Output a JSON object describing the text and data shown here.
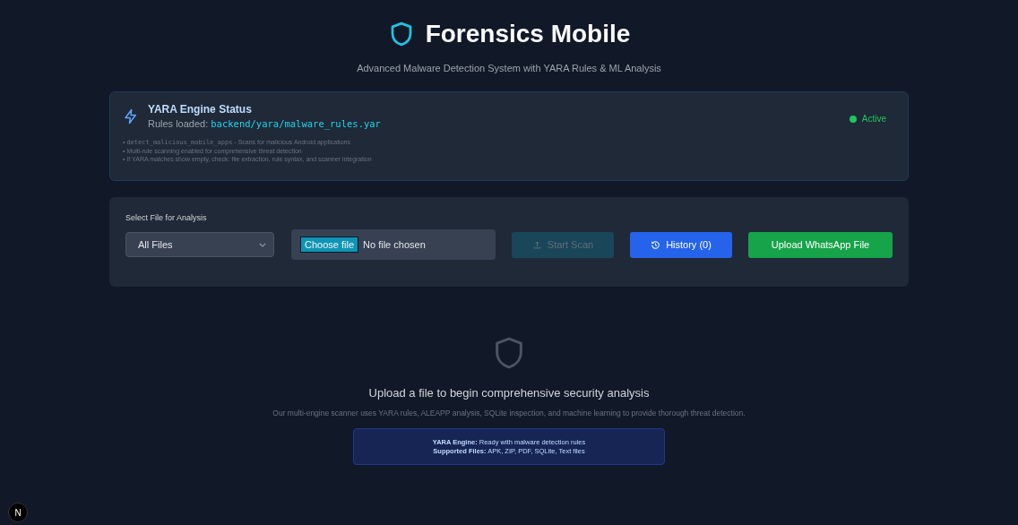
{
  "header": {
    "title": "Forensics Mobile",
    "subtitle": "Advanced Malware Detection System with YARA Rules & ML Analysis"
  },
  "engine_status": {
    "title": "YARA Engine Status",
    "rules_label": "Rules loaded:",
    "rules_path": "backend/yara/malware_rules.yar",
    "status": {
      "label": "Active",
      "active": true
    },
    "notes": [
      {
        "bullet": "•",
        "code": "detect_malicious_mobile_apps",
        "text": " - Scans for malicious Android applications"
      },
      {
        "bullet": "•",
        "text": "Multi-rule scanning enabled for comprehensive threat detection"
      },
      {
        "bullet": "•",
        "text": "If YARA matches show empty, check: file extraction, rule syntax, and scanner integration"
      }
    ]
  },
  "file_panel": {
    "label": "Select File for Analysis",
    "file_type": {
      "value": "All Files"
    },
    "file_input": {
      "button": "Choose file",
      "status": "No file chosen"
    },
    "buttons": [
      {
        "kind": "scan",
        "label": "Start Scan",
        "disabled": true
      },
      {
        "kind": "history",
        "label": "History (0)",
        "disabled": false
      },
      {
        "kind": "whatsapp",
        "label": "Upload WhatsApp File",
        "disabled": false
      }
    ]
  },
  "empty_state": {
    "heading": "Upload a file to begin comprehensive security analysis",
    "description": "Our multi-engine scanner uses YARA rules, ALEAPP analysis, SQLite inspection, and machine learning to provide thorough threat detection.",
    "info": [
      "**YARA Engine:** Ready with malware detection rules",
      "**Supported Files:** APK, ZIP, PDF, SQLite, Text files"
    ]
  },
  "dev_badge": "N"
}
